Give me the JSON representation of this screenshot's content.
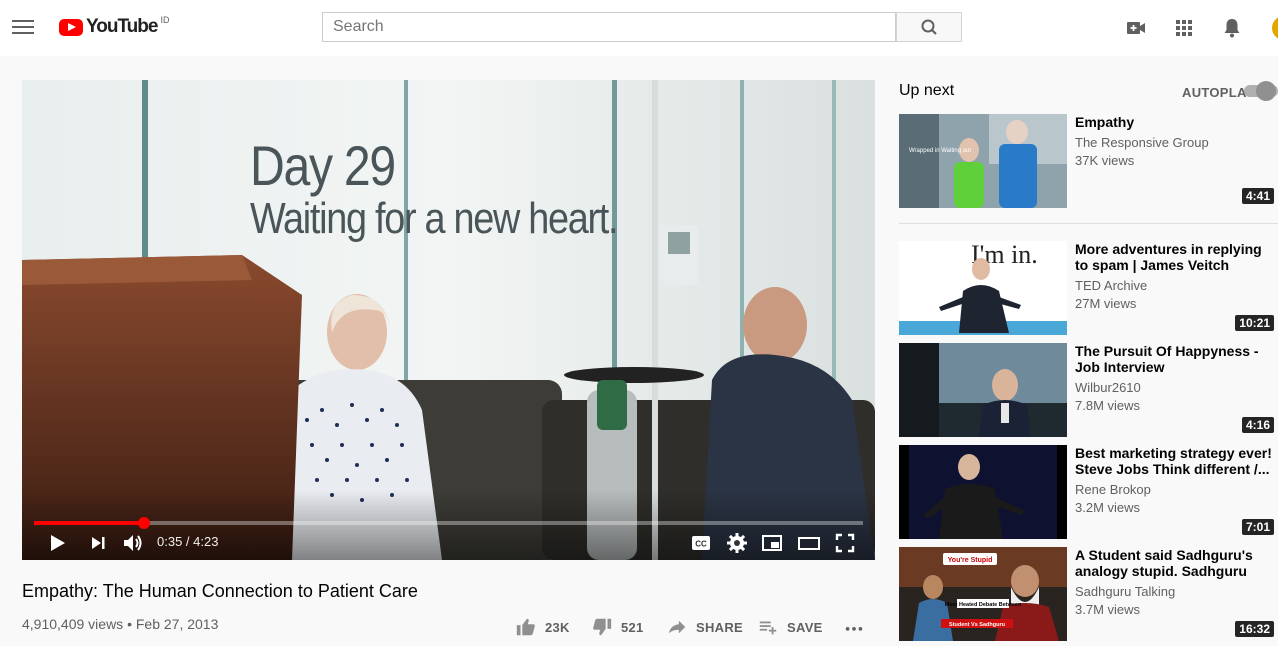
{
  "masthead": {
    "logo_text": "YouTube",
    "region": "ID",
    "search_placeholder": "Search",
    "icons": [
      "menu-icon",
      "search-icon",
      "create-video-icon",
      "apps-icon",
      "notifications-icon"
    ]
  },
  "player": {
    "overlay_line1": "Day 29",
    "overlay_line2": "Waiting for a new heart.",
    "time_current": "0:35",
    "time_total": "4:23",
    "time_display": "0:35 / 4:23",
    "progress_fraction": 0.133
  },
  "video": {
    "title": "Empathy: The Human Connection to Patient Care",
    "meta": "4,910,409 views • Feb 27, 2013",
    "likes": "23K",
    "dislikes": "521",
    "share_label": "SHARE",
    "save_label": "SAVE"
  },
  "sidebar": {
    "up_next_label": "Up next",
    "autoplay_label": "AUTOPLAY",
    "items": [
      {
        "title": "Empathy",
        "channel": "The Responsive Group",
        "views": "37K views",
        "duration": "4:41",
        "thumb_text": "Wrapped in Waiting out"
      },
      {
        "title": "More adventures in replying to spam | James Veitch",
        "channel": "TED Archive",
        "views": "27M views",
        "duration": "10:21",
        "thumb_text": "I'm in."
      },
      {
        "title": "The Pursuit Of Happyness - Job Interview",
        "channel": "Wilbur2610",
        "views": "7.8M views",
        "duration": "4:16",
        "thumb_text": ""
      },
      {
        "title": "Best marketing strategy ever! Steve Jobs Think different /...",
        "channel": "Rene Brokop",
        "views": "3.2M views",
        "duration": "7:01",
        "thumb_text": ""
      },
      {
        "title": "A Student said Sadhguru's analogy stupid. Sadhguru shut...",
        "channel": "Sadhguru Talking",
        "views": "3.7M views",
        "duration": "16:32",
        "thumb_text": "You're Stupid",
        "thumb_text2": "Most Heated Debate Between",
        "thumb_text3": "Student Vs Sadhguru"
      }
    ]
  },
  "colors": {
    "brand_red": "#ff0000",
    "text_primary": "#030303",
    "text_secondary": "#606060",
    "page_bg": "#f9f9f9"
  }
}
